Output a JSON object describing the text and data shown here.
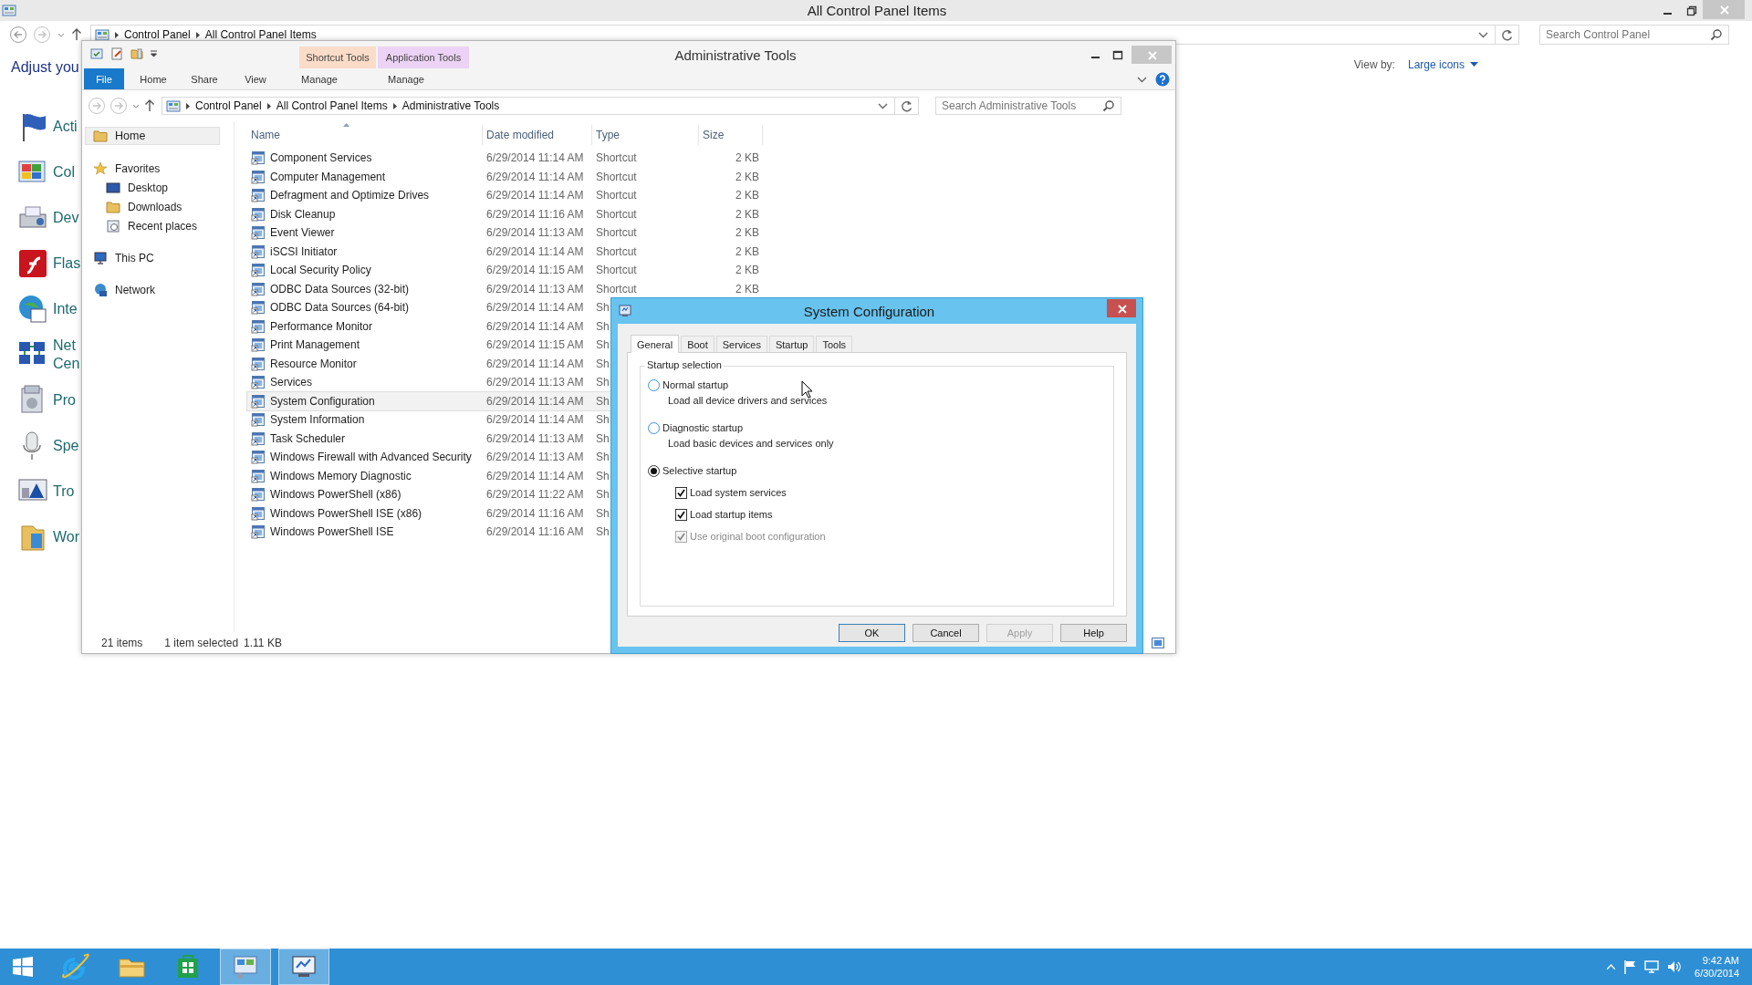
{
  "background_window": {
    "title": "All Control Panel Items",
    "address_segments": [
      "Control Panel",
      "All Control Panel Items"
    ],
    "search": {
      "placeholder": "Search Control Panel"
    },
    "heading": "Adjust you",
    "view_by_label": "View by:",
    "view_by_value": "Large icons",
    "items": [
      {
        "lines": [
          "Acti"
        ]
      },
      {
        "lines": [
          "Col"
        ]
      },
      {
        "lines": [
          "Dev"
        ]
      },
      {
        "lines": [
          "Flas"
        ]
      },
      {
        "lines": [
          "Inte"
        ]
      },
      {
        "lines": [
          "Net",
          "Cen"
        ]
      },
      {
        "lines": [
          "Pro"
        ]
      },
      {
        "lines": [
          "Spe"
        ]
      },
      {
        "lines": [
          "Tro"
        ]
      },
      {
        "lines": [
          "Wor"
        ]
      }
    ]
  },
  "explorer": {
    "title": "Administrative Tools",
    "ribbon_tabs": [
      {
        "label": "File",
        "kind": "file"
      },
      {
        "label": "Home",
        "kind": "tab"
      },
      {
        "label": "Share",
        "kind": "tab"
      },
      {
        "label": "View",
        "kind": "tab"
      }
    ],
    "context_tabs": [
      {
        "label": "Shortcut Tools",
        "color": "#fbdcc8",
        "tab": "Manage"
      },
      {
        "label": "Application Tools",
        "color": "#ecd3f5",
        "tab": "Manage"
      }
    ],
    "address_segments": [
      "Control Panel",
      "All Control Panel Items",
      "Administrative Tools"
    ],
    "search": {
      "placeholder": "Search Administrative Tools"
    },
    "nav": [
      {
        "label": "Home",
        "kind": "folder",
        "selected": true
      },
      {
        "label": "Favorites",
        "kind": "star",
        "selected": false,
        "children": [
          {
            "label": "Desktop",
            "kind": "desktop",
            "selected": false
          },
          {
            "label": "Downloads",
            "kind": "folder",
            "selected": false
          },
          {
            "label": "Recent places",
            "kind": "recent",
            "selected": false
          }
        ]
      },
      {
        "label": "This PC",
        "kind": "pc",
        "selected": false
      },
      {
        "label": "Network",
        "kind": "network",
        "selected": false
      }
    ],
    "columns": [
      "Name",
      "Date modified",
      "Type",
      "Size"
    ],
    "rows": [
      {
        "name": "Component Services",
        "date": "6/29/2014 11:14 AM",
        "type": "Shortcut",
        "size": "2 KB",
        "selected": false
      },
      {
        "name": "Computer Management",
        "date": "6/29/2014 11:14 AM",
        "type": "Shortcut",
        "size": "2 KB",
        "selected": false
      },
      {
        "name": "Defragment and Optimize Drives",
        "date": "6/29/2014 11:14 AM",
        "type": "Shortcut",
        "size": "2 KB",
        "selected": false
      },
      {
        "name": "Disk Cleanup",
        "date": "6/29/2014 11:16 AM",
        "type": "Shortcut",
        "size": "2 KB",
        "selected": false
      },
      {
        "name": "Event Viewer",
        "date": "6/29/2014 11:13 AM",
        "type": "Shortcut",
        "size": "2 KB",
        "selected": false
      },
      {
        "name": "iSCSI Initiator",
        "date": "6/29/2014 11:14 AM",
        "type": "Shortcut",
        "size": "2 KB",
        "selected": false
      },
      {
        "name": "Local Security Policy",
        "date": "6/29/2014 11:15 AM",
        "type": "Shortcut",
        "size": "2 KB",
        "selected": false
      },
      {
        "name": "ODBC Data Sources (32-bit)",
        "date": "6/29/2014 11:13 AM",
        "type": "Shortcut",
        "size": "2 KB",
        "selected": false
      },
      {
        "name": "ODBC Data Sources (64-bit)",
        "date": "6/29/2014 11:14 AM",
        "type": "Sh",
        "selected": false
      },
      {
        "name": "Performance Monitor",
        "date": "6/29/2014 11:14 AM",
        "type": "Sh",
        "selected": false
      },
      {
        "name": "Print Management",
        "date": "6/29/2014 11:15 AM",
        "type": "Sh",
        "selected": false
      },
      {
        "name": "Resource Monitor",
        "date": "6/29/2014 11:14 AM",
        "type": "Sh",
        "selected": false
      },
      {
        "name": "Services",
        "date": "6/29/2014 11:13 AM",
        "type": "Sh",
        "selected": false
      },
      {
        "name": "System Configuration",
        "date": "6/29/2014 11:14 AM",
        "type": "Sh",
        "selected": true
      },
      {
        "name": "System Information",
        "date": "6/29/2014 11:14 AM",
        "type": "Sh",
        "selected": false
      },
      {
        "name": "Task Scheduler",
        "date": "6/29/2014 11:13 AM",
        "type": "Sh",
        "selected": false
      },
      {
        "name": "Windows Firewall with Advanced Security",
        "date": "6/29/2014 11:13 AM",
        "type": "Sh",
        "selected": false
      },
      {
        "name": "Windows Memory Diagnostic",
        "date": "6/29/2014 11:14 AM",
        "type": "Sh",
        "selected": false
      },
      {
        "name": "Windows PowerShell (x86)",
        "date": "6/29/2014 11:22 AM",
        "type": "Sh",
        "selected": false
      },
      {
        "name": "Windows PowerShell ISE (x86)",
        "date": "6/29/2014 11:16 AM",
        "type": "Sh",
        "selected": false
      },
      {
        "name": "Windows PowerShell ISE",
        "date": "6/29/2014 11:16 AM",
        "type": "Sh",
        "selected": false
      }
    ],
    "status": {
      "count": "21 items",
      "selection": "1 item selected",
      "size": "1.11 KB"
    }
  },
  "dialog": {
    "title": "System Configuration",
    "tabs": [
      {
        "label": "General",
        "selected": true
      },
      {
        "label": "Boot",
        "selected": false
      },
      {
        "label": "Services",
        "selected": false
      },
      {
        "label": "Startup",
        "selected": false
      },
      {
        "label": "Tools",
        "selected": false
      }
    ],
    "group_title": "Startup selection",
    "options": [
      {
        "label": "Normal startup",
        "description": "Load all device drivers and services",
        "selected": false
      },
      {
        "label": "Diagnostic startup",
        "description": "Load basic devices and services only",
        "selected": false
      },
      {
        "label": "Selective startup",
        "selected": true
      }
    ],
    "checks": [
      {
        "label": "Load system services",
        "checked": true,
        "disabled": false
      },
      {
        "label": "Load startup items",
        "checked": true,
        "disabled": false
      },
      {
        "label": "Use original boot configuration",
        "checked": true,
        "disabled": true
      }
    ],
    "buttons": [
      {
        "label": "OK",
        "default": true,
        "disabled": false
      },
      {
        "label": "Cancel",
        "default": false,
        "disabled": false
      },
      {
        "label": "Apply",
        "default": false,
        "disabled": true
      },
      {
        "label": "Help",
        "default": false,
        "disabled": false
      }
    ]
  },
  "taskbar": {
    "apps": [
      {
        "kind": "ie",
        "active": false
      },
      {
        "kind": "explorer",
        "active": false
      },
      {
        "kind": "store",
        "active": false
      },
      {
        "kind": "control-panel",
        "active": true
      },
      {
        "kind": "msconfig",
        "active": true
      }
    ],
    "clock": {
      "time": "9:42 AM",
      "date": "6/30/2014"
    }
  }
}
